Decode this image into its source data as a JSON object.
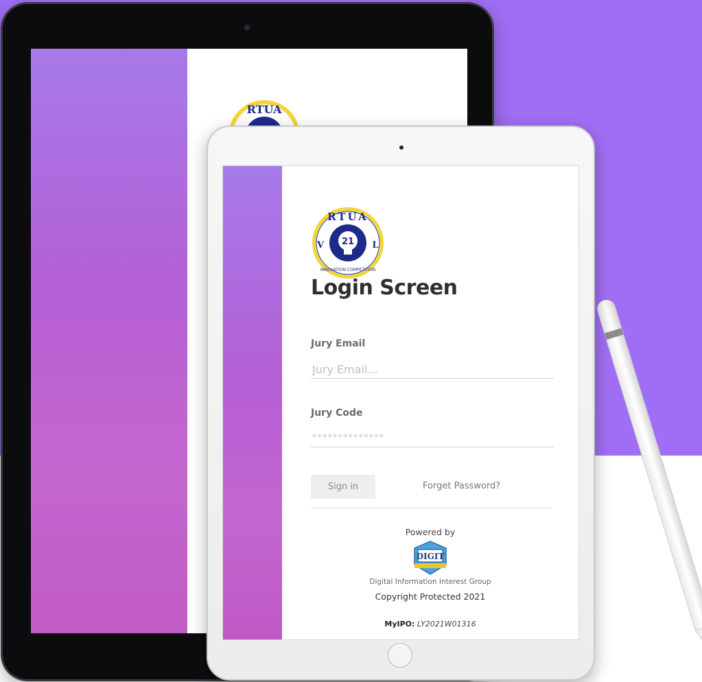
{
  "login": {
    "title": "Login Screen",
    "email_label": "Jury Email",
    "email_placeholder": "Jury Email...",
    "code_label": "Jury Code",
    "code_placeholder": "**************",
    "signin_label": "Sign in",
    "forget_label": "Forget Password?"
  },
  "logo": {
    "arc_top": "RTUA",
    "left_letter": "V",
    "right_letter": "L",
    "center_number": "21",
    "bottom_text": "INNOVATION COMPETITION",
    "icon": "lightbulb-icon"
  },
  "footer": {
    "powered_by": "Powered by",
    "digit_text": "DIGIT",
    "org_name": "Digital Information Interest Group",
    "copyright": "Copyright Protected 2021",
    "myipo_label": "MyIPO:",
    "myipo_value": "LY2021W01316"
  },
  "colors": {
    "background_purple": "#a06ef5",
    "panel_gradient_top": "#a77ae8",
    "panel_gradient_bottom": "#c25bc6",
    "logo_navy": "#1c2a8a",
    "logo_yellow": "#f4d437"
  }
}
